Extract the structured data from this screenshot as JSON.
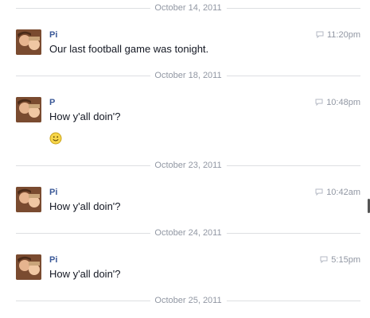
{
  "thread": {
    "messages": [
      {
        "date": "October 14, 2011",
        "sender": "Pi",
        "time": "11:20pm",
        "text": "Our last football game was tonight."
      },
      {
        "date": "October 18, 2011",
        "sender": "P",
        "time": "10:48pm",
        "text": "How y'all doin'?",
        "emoji": "smiley-icon"
      },
      {
        "date": "October 23, 2011",
        "sender": "Pi",
        "time": "10:42am",
        "text": "How y'all doin'?"
      },
      {
        "date": "October 24, 2011",
        "sender": "Pi",
        "time": "5:15pm",
        "text": "How y'all doin'?"
      }
    ],
    "trailing_date": "October 25, 2011"
  },
  "colors": {
    "sender_link": "#3b5998",
    "meta_gray": "#9197a3",
    "divider": "#dddfe2"
  }
}
